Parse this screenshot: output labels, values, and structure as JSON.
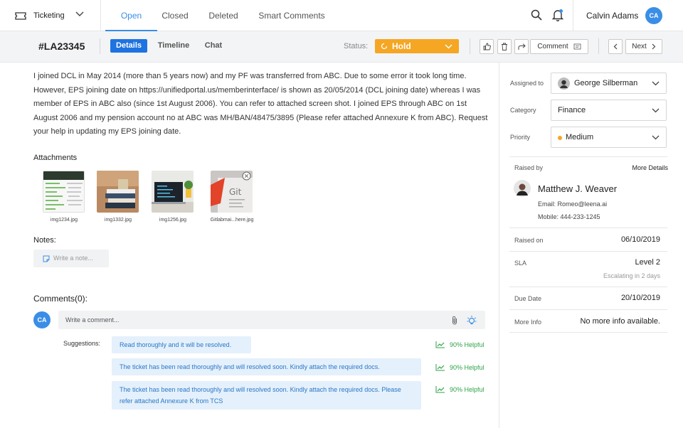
{
  "topnav": {
    "app_name": "Ticketing",
    "tabs": [
      {
        "label": "Open",
        "active": true
      },
      {
        "label": "Closed",
        "active": false
      },
      {
        "label": "Deleted",
        "active": false
      },
      {
        "label": "Smart Comments",
        "active": false
      }
    ],
    "user_name": "Calvin Adams",
    "user_initials": "CA"
  },
  "ticket": {
    "id": "#LA23345",
    "subtabs": [
      "Details",
      "Timeline",
      "Chat"
    ],
    "status_label": "Status:",
    "status_value": "Hold",
    "comment_label": "Comment",
    "next_label": "Next",
    "description": "I joined DCL in May 2014 (more than 5 years now) and my PF was transferred from ABC. Due to some error it took long time. However, EPS joining date on https://unifiedportal.us/memberinterface/ is shown as 20/05/2014 (DCL joining date) whereas I was member of EPS in ABC also (since 1st August 2006). You can refer to attached screen shot. I joined EPS through ABC on 1st August 2006 and my pension account no at ABC was MH/BAN/48475/3895 (Please refer attached Annexure K from ABC). Request your help in updating my EPS joining date."
  },
  "attachments": {
    "heading": "Attachments",
    "files": [
      "img1234.jpg",
      "img1332.jpg",
      "img1256.jpg",
      "Gitlabmai...here.jpg"
    ]
  },
  "notes": {
    "heading": "Notes:",
    "placeholder": "Write a note..."
  },
  "comments": {
    "heading": "Comments(0):",
    "user_initials": "CA",
    "placeholder": "Write a comment...",
    "suggestions_label": "Suggestions:",
    "suggestions": [
      {
        "text": "Read thoroughly and it will be resolved.",
        "helpful": "90% Helpful"
      },
      {
        "text": "The ticket has been read thoroughly and will resolved soon. Kindly attach the required docs.",
        "helpful": "90% Helpful"
      },
      {
        "text": "The ticket has been read thoroughly and will resolved soon. Kindly attach the required docs. Please refer attached Annexure K from TCS",
        "helpful": "90% Helpful"
      }
    ]
  },
  "sidebar": {
    "assigned_label": "Assigned to",
    "assigned_value": "George Silberman",
    "category_label": "Category",
    "category_value": "Finance",
    "priority_label": "Priority",
    "priority_value": "Medium",
    "raised_by_label": "Raised by",
    "more_details": "More Details",
    "raiser_name": "Matthew J. Weaver",
    "raiser_email": "Email: Romeo@leena.ai",
    "raiser_mobile": "Mobile: 444-233-1245",
    "raised_on_label": "Raised on",
    "raised_on_value": "06/10/2019",
    "sla_label": "SLA",
    "sla_value": "Level 2",
    "sla_note": "Escalating in 2 days",
    "due_label": "Due Date",
    "due_value": "20/10/2019",
    "more_info_label": "More Info",
    "more_info_value": "No more info available."
  },
  "colors": {
    "accent": "#1f73e0",
    "status_hold": "#f5a623",
    "priority_medium": "#f5a623",
    "helpful_green": "#2fa34a"
  }
}
